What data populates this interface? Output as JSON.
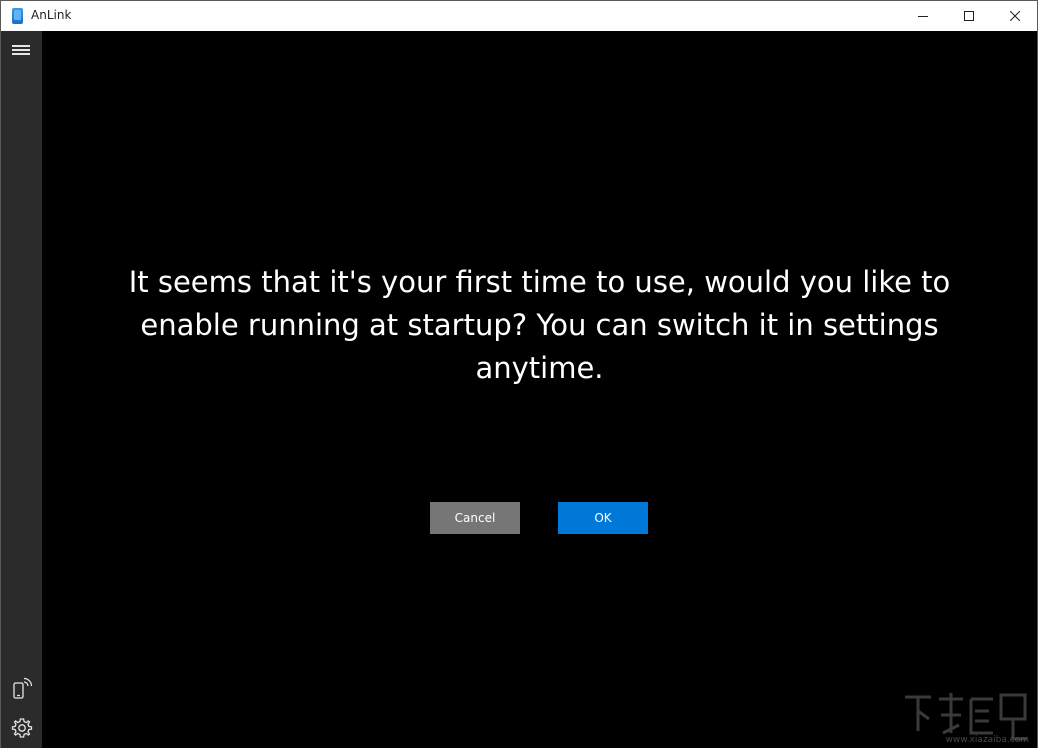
{
  "window": {
    "title": "AnLink",
    "controls": {
      "minimize_icon": "minimize-icon",
      "maximize_icon": "maximize-icon",
      "close_icon": "close-icon"
    }
  },
  "sidebar": {
    "menu_icon": "hamburger-menu-icon",
    "bottom_items": [
      {
        "icon": "phone-connect-icon"
      },
      {
        "icon": "gear-icon"
      }
    ]
  },
  "main": {
    "prompt": "It seems that it's your first time to use, would you like to enable running at startup? You can switch it in settings anytime.",
    "buttons": {
      "cancel_label": "Cancel",
      "ok_label": "OK"
    }
  },
  "watermark": {
    "url": "www.xiazaiba.com"
  },
  "colors": {
    "background": "#000000",
    "sidebar": "#2b2b2b",
    "cancel_button": "#767676",
    "ok_button": "#0078d7",
    "text": "#ffffff"
  }
}
